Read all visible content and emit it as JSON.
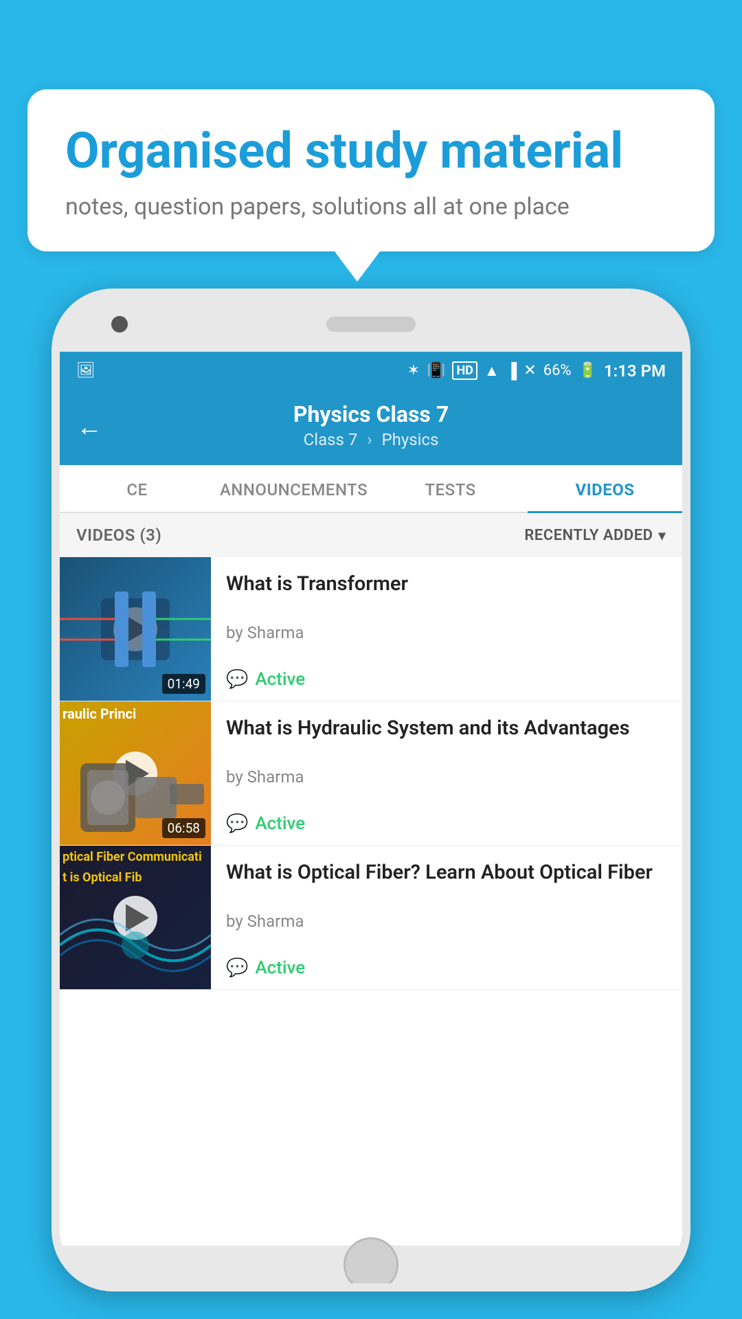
{
  "background_color": "#29b6e8",
  "bubble": {
    "title": "Organised study material",
    "subtitle": "notes, question papers, solutions all at one place"
  },
  "status_bar": {
    "time": "1:13 PM",
    "battery": "66%",
    "icons": [
      "bluetooth",
      "vibrate",
      "hd",
      "wifi",
      "signal",
      "signal-x"
    ]
  },
  "app_bar": {
    "back_label": "←",
    "title": "Physics Class 7",
    "breadcrumb_class": "Class 7",
    "breadcrumb_subject": "Physics"
  },
  "tabs": [
    {
      "id": "ce",
      "label": "CE",
      "active": false
    },
    {
      "id": "announcements",
      "label": "ANNOUNCEMENTS",
      "active": false
    },
    {
      "id": "tests",
      "label": "TESTS",
      "active": false
    },
    {
      "id": "videos",
      "label": "VIDEOS",
      "active": true
    }
  ],
  "videos_section": {
    "count_label": "VIDEOS (3)",
    "sort_label": "RECENTLY ADDED"
  },
  "videos": [
    {
      "title": "What is  Transformer",
      "author": "by Sharma",
      "status": "Active",
      "duration": "01:49",
      "thumbnail_type": "transformer"
    },
    {
      "title": "What is Hydraulic System and its Advantages",
      "author": "by Sharma",
      "status": "Active",
      "duration": "06:58",
      "thumbnail_type": "hydraulic",
      "thumbnail_text": "raulic Princi"
    },
    {
      "title": "What is Optical Fiber? Learn About Optical Fiber",
      "author": "by Sharma",
      "status": "Active",
      "duration": "",
      "thumbnail_type": "optical",
      "thumbnail_text1": "ptical Fiber Communicati",
      "thumbnail_text2": "t is Optical Fib"
    }
  ]
}
